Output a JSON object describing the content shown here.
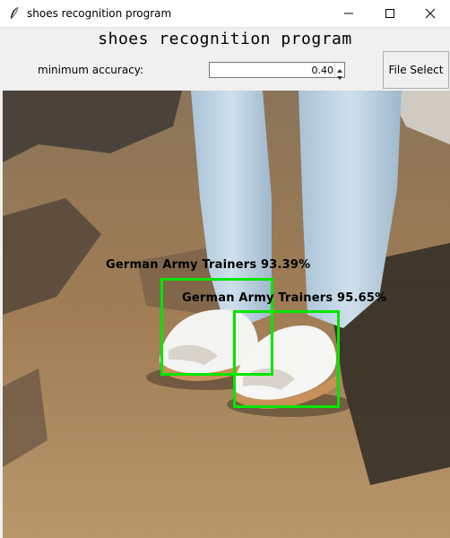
{
  "window": {
    "title": "shoes recognition program",
    "icon": "feather-icon"
  },
  "app": {
    "heading": "shoes recognition program"
  },
  "controls": {
    "accuracy_label": "minimum accuracy:",
    "accuracy_value": "0.40",
    "file_select_label": "File Select"
  },
  "detections": [
    {
      "label": "German Army Trainers 93.39%",
      "color": "#00e600"
    },
    {
      "label": "German Army Trainers 95.65%",
      "color": "#00e600"
    }
  ],
  "colors": {
    "box": "#00e600",
    "background": "#f0f0f0"
  }
}
